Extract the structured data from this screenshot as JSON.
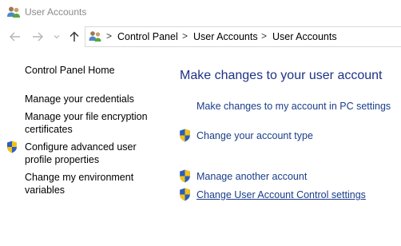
{
  "window": {
    "title": "User Accounts",
    "icon": "users-icon"
  },
  "nav": {
    "back_icon": "arrow-left-icon",
    "forward_icon": "arrow-right-icon",
    "recent_icon": "chevron-down-icon",
    "up_icon": "arrow-up-icon"
  },
  "address": {
    "icon": "control-panel-icon",
    "separator": ">",
    "crumbs": [
      "Control Panel",
      "User Accounts",
      "User Accounts"
    ]
  },
  "sidebar": {
    "items": [
      {
        "label": "Control Panel Home",
        "shield": false
      },
      {
        "label": "Manage your credentials",
        "shield": false
      },
      {
        "label": "Manage your file encryption certificates",
        "shield": false
      },
      {
        "label": "Configure advanced user profile properties",
        "shield": true
      },
      {
        "label": "Change my environment variables",
        "shield": false
      }
    ]
  },
  "main": {
    "title": "Make changes to your user account",
    "links": [
      {
        "label": "Make changes to my account in PC settings",
        "shield": false
      },
      {
        "label": "Change your account type",
        "shield": true
      },
      {
        "label": "Manage another account",
        "shield": true
      },
      {
        "label": "Change User Account Control settings",
        "shield": true
      }
    ]
  },
  "colors": {
    "link": "#1a3d8a",
    "heading": "#1e3287",
    "shield_blue": "#2c5fb8",
    "shield_yellow": "#f2c21b"
  }
}
